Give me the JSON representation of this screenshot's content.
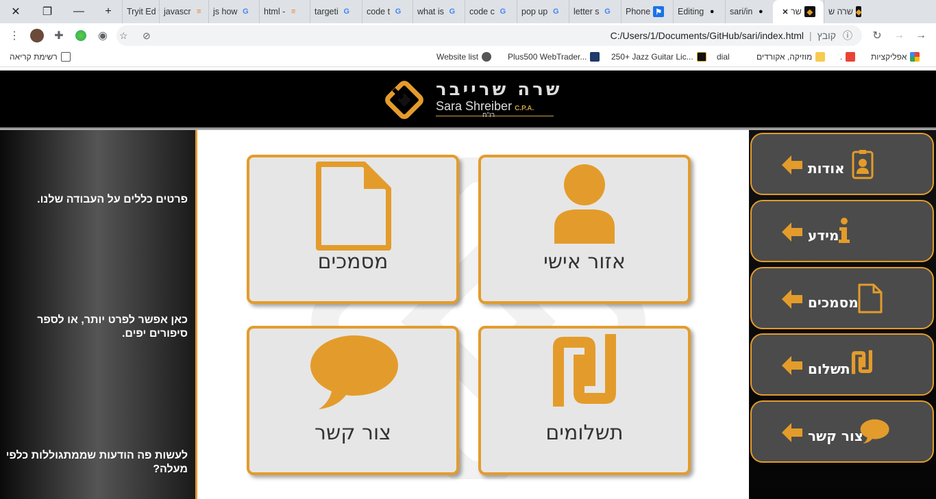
{
  "browser": {
    "tabs": [
      {
        "title": "Tryit Ed"
      },
      {
        "title": "javascr"
      },
      {
        "title": "js how"
      },
      {
        "title": "html -"
      },
      {
        "title": "targeti"
      },
      {
        "title": "code t"
      },
      {
        "title": "what is"
      },
      {
        "title": "code c"
      },
      {
        "title": "pop up"
      },
      {
        "title": "letter s"
      },
      {
        "title": "Phone"
      },
      {
        "title": "Editing"
      },
      {
        "title": "sari/in"
      },
      {
        "title": "שר"
      },
      {
        "title": "שרה ש"
      }
    ],
    "address": "C:/Users/1/Documents/GitHub/sari/index.html",
    "address_scheme_label": "קובץ",
    "bookmarks": [
      {
        "label": "רשימת קריאה"
      },
      {
        "label": "Website list"
      },
      {
        "label": "Plus500 WebTrader..."
      },
      {
        "label": "250+ Jazz Guitar Lic..."
      },
      {
        "label": "dial"
      },
      {
        "label": "מוזיקה, אקורדים"
      },
      {
        "label": "."
      },
      {
        "label": "אפליקציות"
      }
    ],
    "colors": {
      "tabbar": "#dee1e6",
      "accent": "#e39c2b"
    }
  },
  "site": {
    "logo": {
      "title_he": "שרה שרייבר",
      "title_en": "Sara Shreiber",
      "cpa": "C.P.A.",
      "suffix_he": "רו\"ח"
    },
    "left_notes": [
      "פרטים כללים על העבודה שלנו.",
      "כאן אפשר לפרט יותר, או לספר סיפורים יפים.",
      "לעשות פה הודעות שממתגוללות כלפי מעלה?"
    ],
    "cards": [
      {
        "label": "אזור אישי",
        "icon": "person-icon"
      },
      {
        "label": "מסמכים",
        "icon": "document-icon"
      },
      {
        "label": "תשלומים",
        "icon": "shekel-icon"
      },
      {
        "label": "צור קשר",
        "icon": "speech-bubble-icon"
      }
    ],
    "nav": [
      {
        "label": "אודות",
        "icon": "id-badge-icon"
      },
      {
        "label": "מידע",
        "icon": "info-icon"
      },
      {
        "label": "מסמכים",
        "icon": "document-icon"
      },
      {
        "label": "תשלום",
        "icon": "shekel-icon"
      },
      {
        "label": "צור קשר",
        "icon": "speech-bubble-icon"
      }
    ],
    "colors": {
      "gold": "#e39c2b",
      "nav_bg": "#4b4b4b",
      "card_bg": "#e6e6e6"
    }
  }
}
